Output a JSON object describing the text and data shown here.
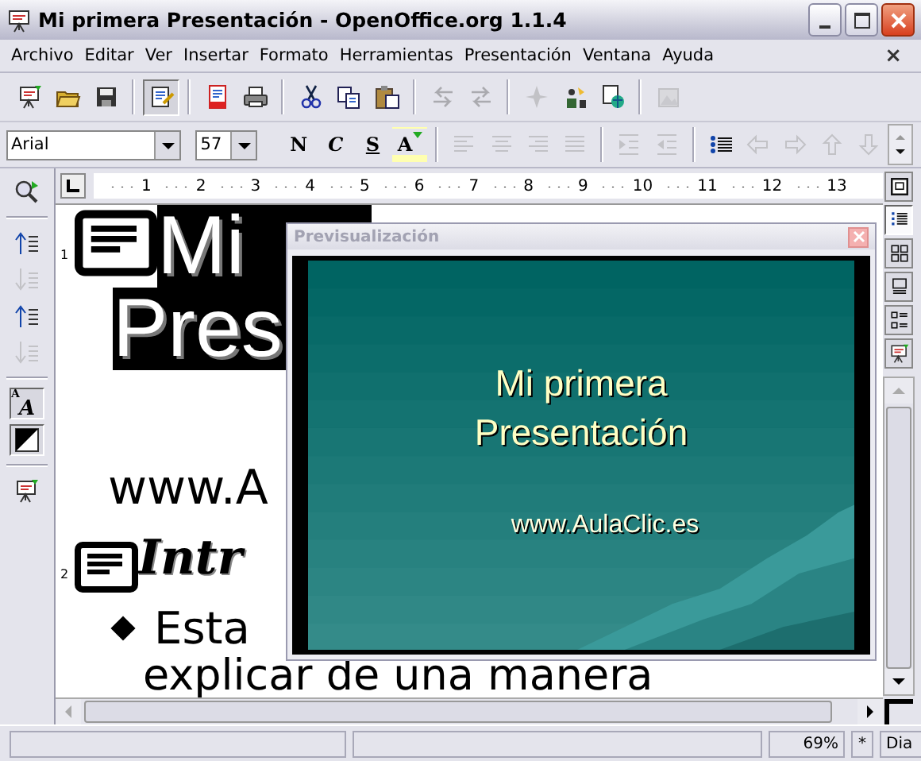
{
  "window": {
    "title": "Mi primera Presentación - OpenOffice.org 1.1.4"
  },
  "menu": {
    "items": [
      "Archivo",
      "Editar",
      "Ver",
      "Insertar",
      "Formato",
      "Herramientas",
      "Presentación",
      "Ventana",
      "Ayuda"
    ],
    "close": "×"
  },
  "standard_toolbar": {
    "groups": [
      {
        "items": [
          {
            "kind": "new",
            "disabled": false,
            "pressed": false
          },
          {
            "kind": "open",
            "disabled": false,
            "pressed": false
          },
          {
            "kind": "save",
            "disabled": false,
            "pressed": false
          }
        ]
      },
      {
        "items": [
          {
            "kind": "edit",
            "disabled": false,
            "pressed": true
          }
        ]
      },
      {
        "items": [
          {
            "kind": "pdf",
            "disabled": false,
            "pressed": false
          },
          {
            "kind": "print",
            "disabled": false,
            "pressed": false
          }
        ]
      },
      {
        "items": [
          {
            "kind": "cut",
            "disabled": false,
            "pressed": false
          },
          {
            "kind": "copy",
            "disabled": false,
            "pressed": false
          },
          {
            "kind": "paste",
            "disabled": false,
            "pressed": false
          }
        ]
      },
      {
        "items": [
          {
            "kind": "undo",
            "disabled": true,
            "pressed": false
          },
          {
            "kind": "redo",
            "disabled": true,
            "pressed": false
          }
        ]
      },
      {
        "items": [
          {
            "kind": "navigator",
            "disabled": true,
            "pressed": false
          },
          {
            "kind": "gallery",
            "disabled": false,
            "pressed": false
          },
          {
            "kind": "globe",
            "disabled": false,
            "pressed": false
          }
        ]
      },
      {
        "items": [
          {
            "kind": "image",
            "disabled": true,
            "pressed": false
          }
        ]
      }
    ]
  },
  "format_toolbar": {
    "font": "Arial",
    "size": "57",
    "groups": [
      {
        "items": [
          {
            "kind": "bold",
            "label": "N",
            "disabled": false
          },
          {
            "kind": "italic",
            "label": "C",
            "disabled": false
          },
          {
            "kind": "underline",
            "label": "S",
            "disabled": false
          },
          {
            "kind": "color",
            "label": "A",
            "disabled": false
          }
        ]
      },
      {
        "items": [
          {
            "kind": "align-left",
            "disabled": true
          },
          {
            "kind": "align-center",
            "disabled": true
          },
          {
            "kind": "align-right",
            "disabled": true
          },
          {
            "kind": "justify",
            "disabled": true
          }
        ]
      },
      {
        "items": [
          {
            "kind": "indent-more",
            "disabled": true
          },
          {
            "kind": "indent-less",
            "disabled": true
          }
        ]
      },
      {
        "items": [
          {
            "kind": "bullets",
            "disabled": false
          },
          {
            "kind": "left",
            "disabled": true
          },
          {
            "kind": "right",
            "disabled": true
          },
          {
            "kind": "up",
            "disabled": true
          },
          {
            "kind": "down",
            "disabled": true
          }
        ]
      }
    ]
  },
  "ruler": {
    "numbers": [
      "1",
      "2",
      "3",
      "4",
      "5",
      "6",
      "7",
      "8",
      "9",
      "10",
      "11",
      "12",
      "13"
    ]
  },
  "left_toolbar": {
    "groups": [
      {
        "items": [
          {
            "kind": "zoom",
            "disabled": false,
            "pressed": false
          }
        ]
      },
      {
        "items": [
          {
            "kind": "promote",
            "disabled": false,
            "pressed": false
          },
          {
            "kind": "demote",
            "disabled": true,
            "pressed": false
          },
          {
            "kind": "move-up",
            "disabled": false,
            "pressed": false
          },
          {
            "kind": "move-down",
            "disabled": true,
            "pressed": false
          }
        ]
      },
      {
        "items": [
          {
            "kind": "formatting",
            "labels": [
              "A",
              "A"
            ],
            "disabled": false,
            "pressed": true
          },
          {
            "kind": "black-white",
            "disabled": false,
            "pressed": true
          }
        ]
      },
      {
        "items": [
          {
            "kind": "slideshow",
            "disabled": false,
            "pressed": false
          }
        ]
      }
    ]
  },
  "outline": {
    "slides": [
      {
        "number": "1",
        "title_lines": [
          "Mi",
          "Pres"
        ],
        "title_selected": true,
        "italic": false,
        "body": [
          {
            "kind": "subtitle",
            "text": "www.A"
          }
        ]
      },
      {
        "number": "2",
        "title_lines": [
          "Intr"
        ],
        "title_selected": false,
        "italic": true,
        "body": [
          {
            "kind": "bullet",
            "text": "Esta"
          },
          {
            "kind": "continuation",
            "text": "explicar de una manera"
          }
        ]
      }
    ]
  },
  "view_buttons": [
    {
      "kind": "drawing",
      "selected": false
    },
    {
      "kind": "outline",
      "selected": true
    },
    {
      "kind": "sorter",
      "selected": false
    },
    {
      "kind": "notes",
      "selected": false
    },
    {
      "kind": "handout",
      "selected": false
    },
    {
      "kind": "slideshow",
      "selected": false
    }
  ],
  "preview": {
    "title": "Previsualización",
    "active": false,
    "slide": {
      "title_lines": [
        "Mi primera",
        "Presentación"
      ],
      "subtitle": "www.AulaClic.es"
    }
  },
  "status_bar": {
    "zoom": "69%",
    "modified": "*",
    "mode": "Dia"
  }
}
